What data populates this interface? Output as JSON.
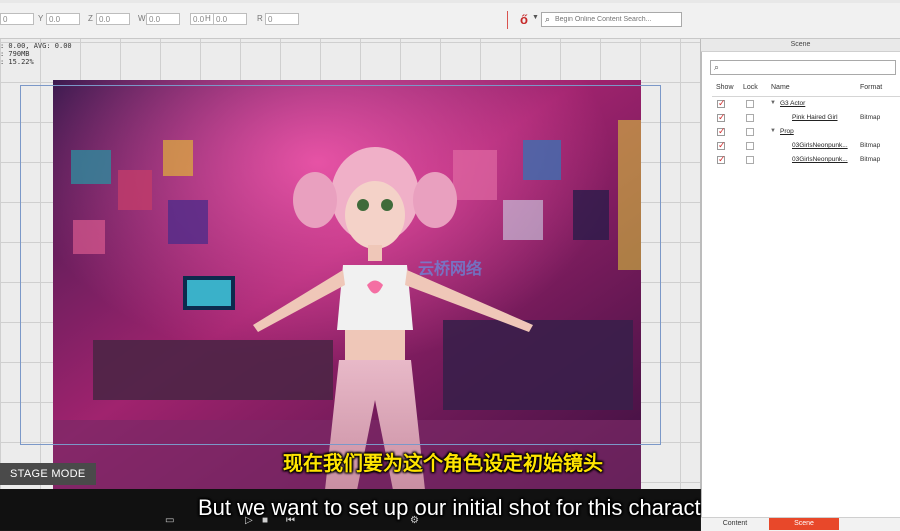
{
  "toolbar": {
    "fields": [
      {
        "label": "",
        "value": "0"
      },
      {
        "label": "Y",
        "value": "0.0"
      },
      {
        "label": "Z",
        "value": "0.0"
      },
      {
        "label": "W",
        "value": "0.0"
      },
      {
        "label": "",
        "value": "0.0"
      },
      {
        "label": "H",
        "value": "0.0"
      },
      {
        "label": "R",
        "value": "0"
      }
    ],
    "search_placeholder": "Begin Online Content Search..."
  },
  "stats": {
    "line1": ": 0.00, AVG: 0.00",
    "line2": ": 790MB",
    "line3": ": 15.22%"
  },
  "stage": {
    "mode_label": "STAGE MODE",
    "watermark": "云桥网络"
  },
  "subtitles": {
    "chinese": "现在我们要为这个角色设定初始镜头",
    "english": "But we want to set up our initial shot for this character"
  },
  "scene_panel": {
    "title": "Scene",
    "columns": {
      "show": "Show",
      "lock": "Lock",
      "name": "Name",
      "format": "Format"
    },
    "rows": [
      {
        "name": "G3 Actor",
        "format": "",
        "expanded": true,
        "show": true,
        "lock": false
      },
      {
        "name": "Pink Haired Girl",
        "format": "Bitmap",
        "show": true,
        "lock": false
      },
      {
        "name": "Prop",
        "format": "",
        "expanded": true,
        "show": true,
        "lock": false
      },
      {
        "name": "03GirlsNeonpunk...",
        "format": "Bitmap",
        "show": true,
        "lock": false
      },
      {
        "name": "03GirlsNeonpunk...",
        "format": "Bitmap",
        "show": true,
        "lock": false
      }
    ],
    "tabs": {
      "content": "Content",
      "scene": "Scene"
    }
  },
  "colors": {
    "accent": "#e8482a",
    "check": "#d32f2f",
    "subtitle_cn": "#ffe500"
  }
}
